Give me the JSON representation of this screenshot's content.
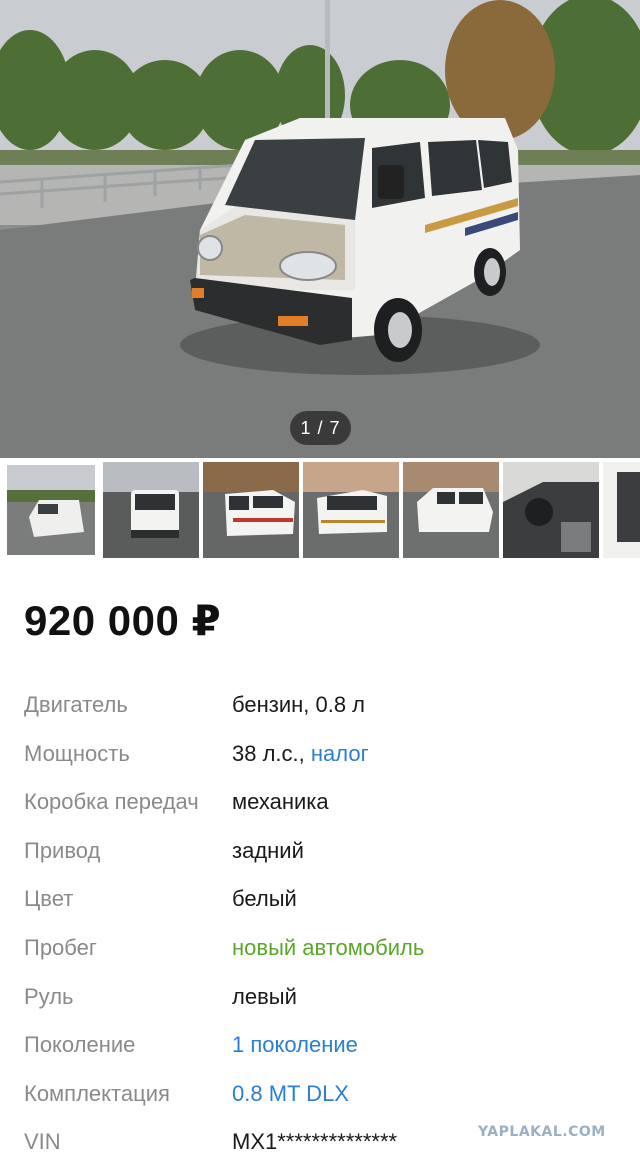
{
  "gallery": {
    "counter": "1 / 7",
    "current": 1,
    "total": 7
  },
  "price": "920 000 ₽",
  "specs": [
    {
      "label": "Двигатель",
      "value": "бензин, 0.8 л"
    },
    {
      "label": "Мощность",
      "value": "38 л.с.,",
      "link": "налог"
    },
    {
      "label": "Коробка передач",
      "value": "механика"
    },
    {
      "label": "Привод",
      "value": "задний"
    },
    {
      "label": "Цвет",
      "value": "белый"
    },
    {
      "label": "Пробег",
      "value": "новый автомобиль"
    },
    {
      "label": "Руль",
      "value": "левый"
    },
    {
      "label": "Поколение",
      "value": "1 поколение"
    },
    {
      "label": "Комплектация",
      "value": "0.8 MT DLX"
    },
    {
      "label": "VIN",
      "value": "MX1**************"
    }
  ],
  "watermark": "YAPLAKAL.COM",
  "colors": {
    "link": "#2a7fd4",
    "new_car": "#5aa628",
    "label": "#8a8a8a"
  }
}
